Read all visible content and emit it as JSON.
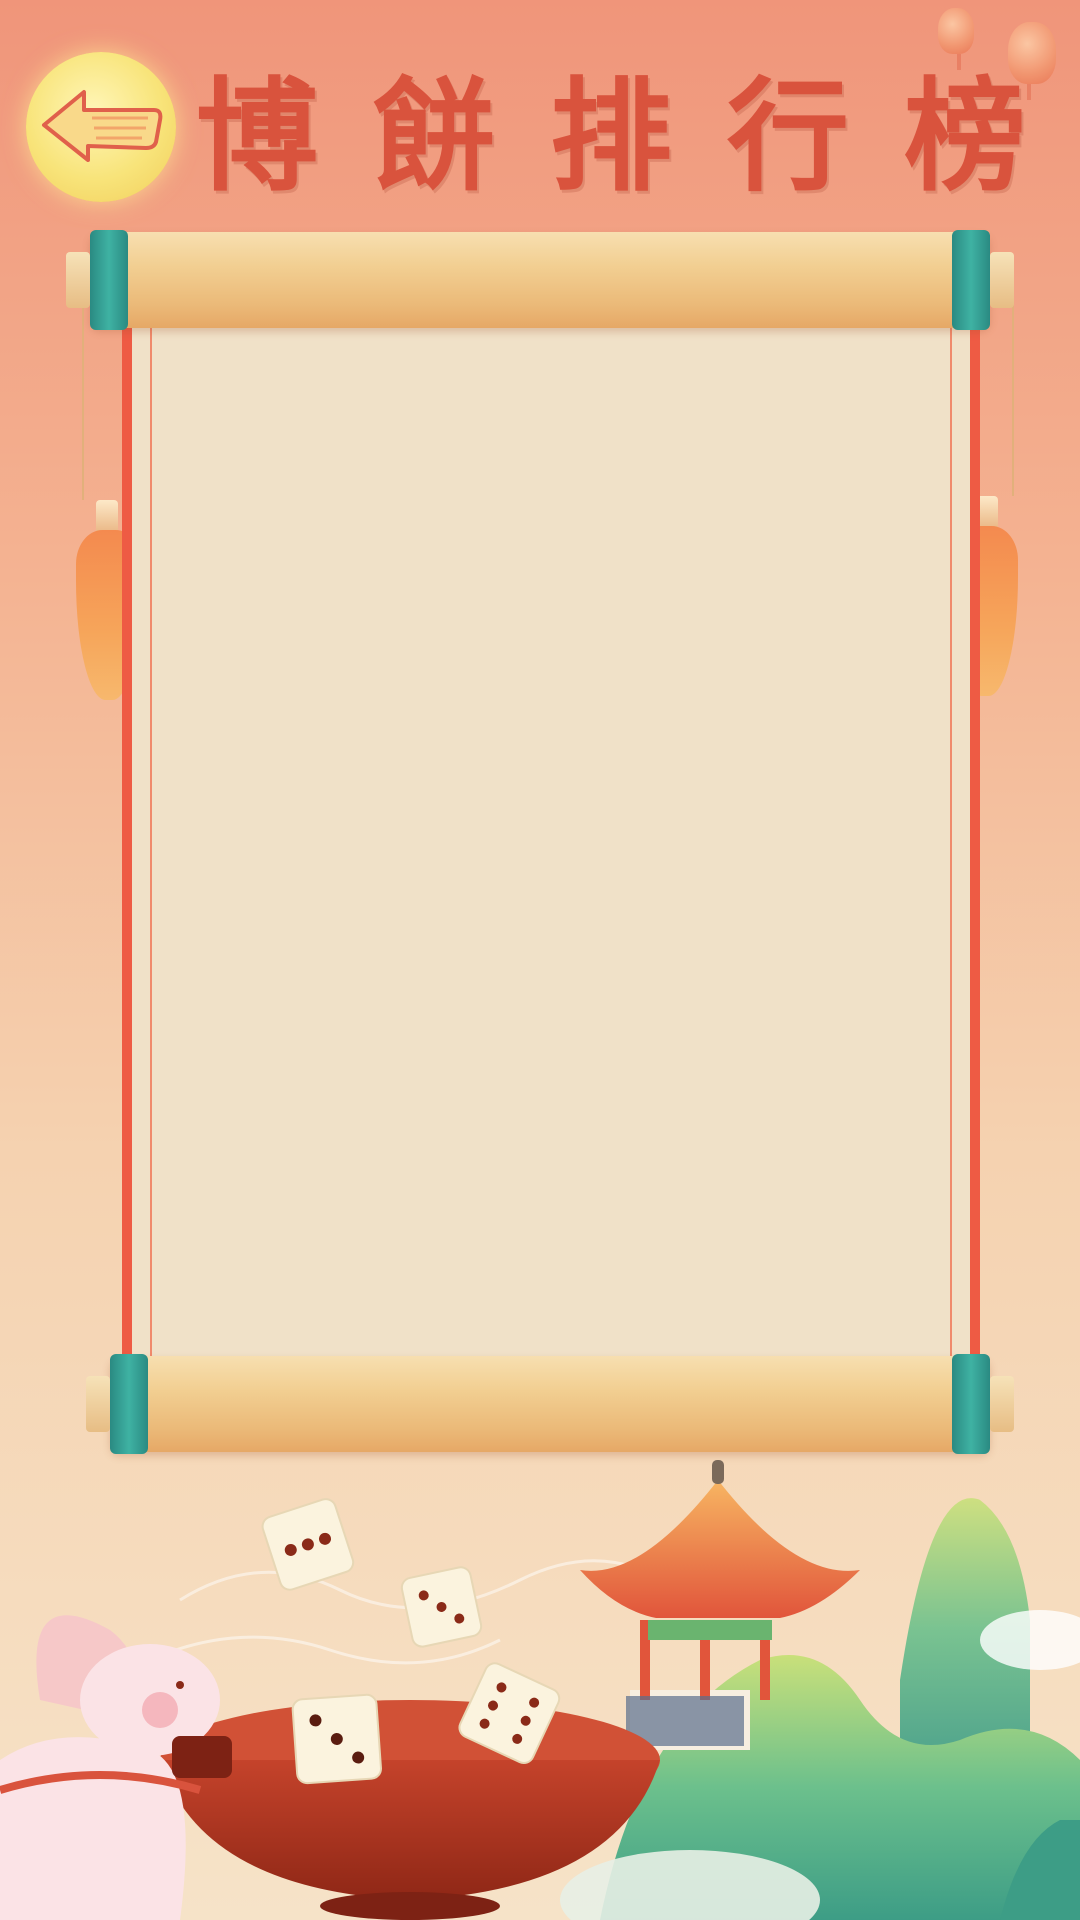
{
  "header": {
    "title": "博餅排行榜",
    "back_icon": "left-arrow-icon"
  },
  "colors": {
    "title": "#d9533d",
    "moon": "#f8e47a",
    "scroll_paper": "#f0e1c8",
    "scroll_border": "#ee5b44",
    "roller_cap": "#3fb2a3"
  },
  "leaderboard": {
    "entries": []
  },
  "scene": {
    "icons": [
      "rabbit-icon",
      "dice-icon",
      "bowl-icon",
      "pavilion-icon",
      "mountain-icon",
      "lantern-icon"
    ]
  }
}
